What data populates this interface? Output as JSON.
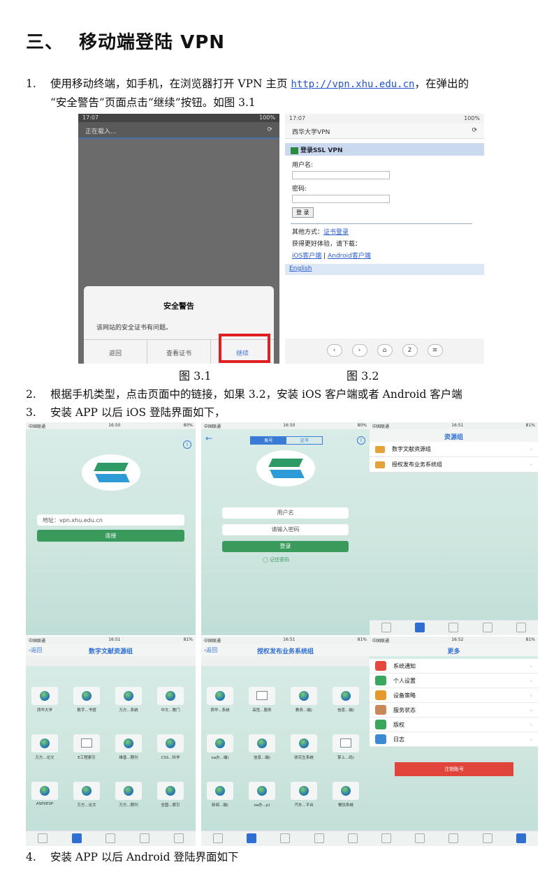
{
  "heading": {
    "number": "三、",
    "title": "移动端登陆 VPN"
  },
  "step1": {
    "index": "1.",
    "text_a": "使用移动终端，如手机，在浏览器打开 VPN 主页 ",
    "link": "http://vpn.xhu.edu.cn",
    "text_b": "，在弹出的",
    "line2": "“安全警告”页面点击“继续”按钮。如图 3.1"
  },
  "fig31": {
    "status_time": "17:07",
    "status_right": "100%",
    "loading": "正在载入...",
    "dialog_title": "安全警告",
    "dialog_message": "该网站的安全证书有问题。",
    "btn_back": "返回",
    "btn_view_cert": "查看证书",
    "btn_continue": "继续",
    "caption": "图 3.1"
  },
  "fig32": {
    "status_time": "17:07",
    "status_right": "100%",
    "page_title": "西华大学VPN",
    "login_header": "登录SSL VPN",
    "username_label": "用户名:",
    "password_label": "密码:",
    "login_button": "登 录",
    "other_methods": "其他方式：",
    "cert_login": "证书登录",
    "better_experience": "获得更好体验，请下载：",
    "ios_client": "iOS客户端",
    "divider": " | ",
    "android_client": "Android客户端",
    "english": "English",
    "nav_page": "2",
    "caption": "图 3.2"
  },
  "step2": {
    "index": "2.",
    "text": "根据手机类型，点击页面中的链接，如果 3.2，安装 iOS 客户端或者 Android 客户端"
  },
  "step3": {
    "index": "3.",
    "text": "安装 APP 以后 iOS 登陆界面如下，"
  },
  "ios": {
    "carrier": "中国联通",
    "s1": {
      "time": "16:50",
      "battery": "80%",
      "address_label": "地址：",
      "address_value": "vpn.xhu.edu.cn",
      "connect": "连接"
    },
    "s2": {
      "time": "16:50",
      "battery": "80%",
      "tab_account": "账号",
      "tab_cert": "证书",
      "username": "用户名",
      "password": "请输入密码",
      "login": "登录",
      "remember": "记住密码"
    },
    "s3": {
      "time": "16:51",
      "battery": "81%",
      "title": "资源组",
      "items": [
        "数字文献资源组",
        "授权发布业务系统组"
      ]
    },
    "s4": {
      "time": "16:51",
      "battery": "81%",
      "back": "返回",
      "title": "数字文献资源组",
      "apps": [
        "西华大学",
        "数字...书馆",
        "万方...系统",
        "中文...教门",
        "万方...论文",
        "E工程索引",
        "维普...期刊",
        "CSS...科学",
        "ASPI/ESP",
        "万方...论文",
        "万方...期刊",
        "全国...索引"
      ]
    },
    "s5": {
      "time": "16:51",
      "battery": "81%",
      "back": "返回",
      "title": "授权发布业务系统组",
      "apps": [
        "西华...系统",
        "高性...服务",
        "教务...端)",
        "信息...端)",
        "oa办...端)",
        "信息...端)",
        "研究生系统",
        "掌上...码)",
        "新闻...端)",
        "oa办...p)",
        "汽车...平台",
        "餐饮系统"
      ]
    },
    "s6": {
      "time": "16:52",
      "battery": "81%",
      "title": "更多",
      "items": [
        "系统通知",
        "个人设置",
        "设备策略",
        "服务状态",
        "版权",
        "日志"
      ],
      "logout": "注销账号"
    }
  },
  "step4": {
    "index": "4.",
    "text": "安装 APP 以后 Android 登陆界面如下"
  }
}
